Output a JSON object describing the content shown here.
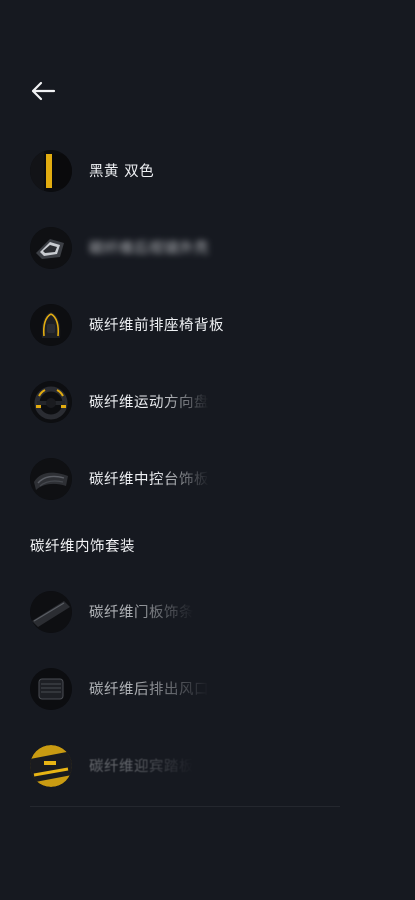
{
  "header": {
    "back_icon": "arrow-left-icon"
  },
  "colors": {
    "background": "#161920",
    "text": "#eef0f3",
    "accent_yellow": "#e8b414"
  },
  "items": [
    {
      "label": "黑黄 双色",
      "thumb_icon": "black-yellow-swatch-icon"
    },
    {
      "label": "碳纤维后视镜外壳",
      "thumb_icon": "mirror-cover-thumb-icon"
    },
    {
      "label": "碳纤维前排座椅背板",
      "thumb_icon": "seat-back-thumb-icon"
    },
    {
      "label": "碳纤维运动方向盘",
      "thumb_icon": "steering-wheel-thumb-icon"
    },
    {
      "label": "碳纤维中控台饰板",
      "thumb_icon": "center-console-thumb-icon"
    }
  ],
  "section": {
    "title": "碳纤维内饰套装"
  },
  "section_items": [
    {
      "label": "碳纤维门板饰条",
      "thumb_icon": "door-trim-thumb-icon"
    },
    {
      "label": "碳纤维后排出风口",
      "thumb_icon": "rear-vent-thumb-icon"
    },
    {
      "label": "碳纤维迎宾踏板",
      "thumb_icon": "sill-plate-thumb-icon"
    }
  ]
}
